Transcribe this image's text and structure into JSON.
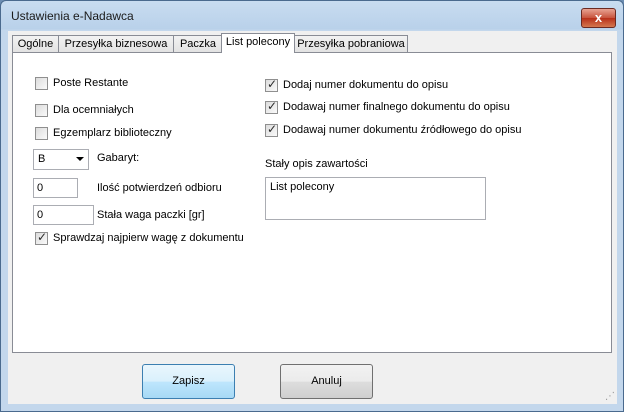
{
  "window": {
    "title": "Ustawienia e-Nadawca",
    "close_glyph": "x"
  },
  "tabs": [
    "Ogólne",
    "Przesyłka biznesowa",
    "Paczka",
    "List polecony",
    "Przesyłka pobraniowa"
  ],
  "active_tab": "List polecony",
  "left": {
    "poste_restante": {
      "label": "Poste Restante",
      "checked": false
    },
    "dla_ociemnialych": {
      "label": "Dla ocemniałych",
      "checked": false
    },
    "egzemplarz": {
      "label": "Egzemplarz biblioteczny",
      "checked": false
    },
    "gabaryt": {
      "value": "B",
      "label": "Gabaryt:"
    },
    "potwierdzenia": {
      "value": "0",
      "label": "Ilość potwierdzeń odbioru"
    },
    "waga": {
      "value": "0",
      "label": "Stała waga paczki [gr]"
    },
    "sprawdzaj": {
      "label": "Sprawdzaj najpierw wagę z dokumentu",
      "checked": true
    }
  },
  "right": {
    "dodaj_numer": {
      "label": "Dodaj numer dokumentu do opisu",
      "checked": true
    },
    "dodawaj_finalny": {
      "label": "Dodawaj numer finalnego dokumentu do opisu",
      "checked": true
    },
    "dodawaj_zrodlowy": {
      "label": "Dodawaj numer dokumentu źródłowego do opisu",
      "checked": true
    },
    "opis_label": "Stały opis zawartości",
    "opis_value": "List polecony"
  },
  "buttons": {
    "save": "Zapisz",
    "cancel": "Anuluj"
  },
  "colors": {
    "title_bar": "#b9d1ea",
    "close_button": "#c7533c",
    "default_button_border": "#3c7fb1"
  }
}
